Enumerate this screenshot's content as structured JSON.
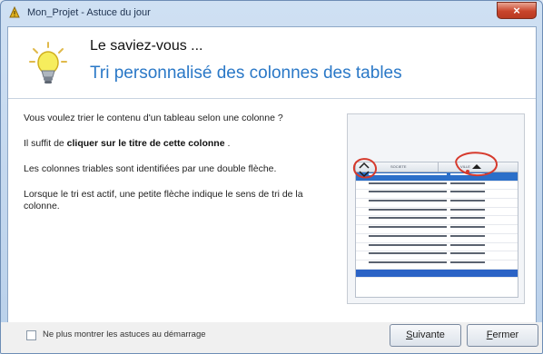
{
  "window": {
    "title": "Mon_Projet - Astuce du jour",
    "close_label": "×"
  },
  "header": {
    "kicker": "Le saviez-vous ...",
    "title": "Tri personnalisé des colonnes des tables"
  },
  "body": {
    "p1": "Vous voulez trier le contenu d'un tableau selon une colonne ?",
    "p2_prefix": "Il suffit de ",
    "p2_bold": "cliquer sur le titre de cette colonne",
    "p2_suffix": ".",
    "p3": "Les colonnes triables sont identifiées par une double flèche.",
    "p4": "Lorsque le tri est actif, une petite flèche indique le sens de tri de la colonne."
  },
  "preview": {
    "col1": "SOCIETE",
    "col2": "VILLE",
    "rows": [
      [
        "LA CAMBRIETTE DES CHOIX",
        "BAZILLETTE"
      ],
      [
        "ELECTRONIQUES GROB SANDOMIR",
        "ARPAJARD"
      ],
      [
        "ROGER DE BRETAGNE",
        "AUBE"
      ],
      [
        "SECRET ARPANIERE",
        "ANNESSY"
      ],
      [
        "LAB ROUTE",
        "AUBERIOTE"
      ],
      [
        "LAURENTINI GOUILLET ENTREPRISE",
        "ARCHAM"
      ],
      [
        "CRAYONDRE",
        "ARMORISAN"
      ],
      [
        "CONSULTANTS INFORMATIQUE",
        "AUTORN"
      ],
      [
        "CIFTET CONCEPT",
        "AUDANE"
      ],
      [
        "MONTELIMANANT",
        "AUTHELINE"
      ],
      [
        "L'FLUEREST DAVIDE ITACHSINDIT",
        "BAUDELAIRE"
      ]
    ],
    "accent_color": "#2b6fc9",
    "annotation_color": "#d63a2d"
  },
  "footer": {
    "checkbox_label": "Ne plus montrer les astuces au démarrage",
    "checkbox_checked": false,
    "next_button": "Suivante",
    "close_button": "Fermer"
  }
}
